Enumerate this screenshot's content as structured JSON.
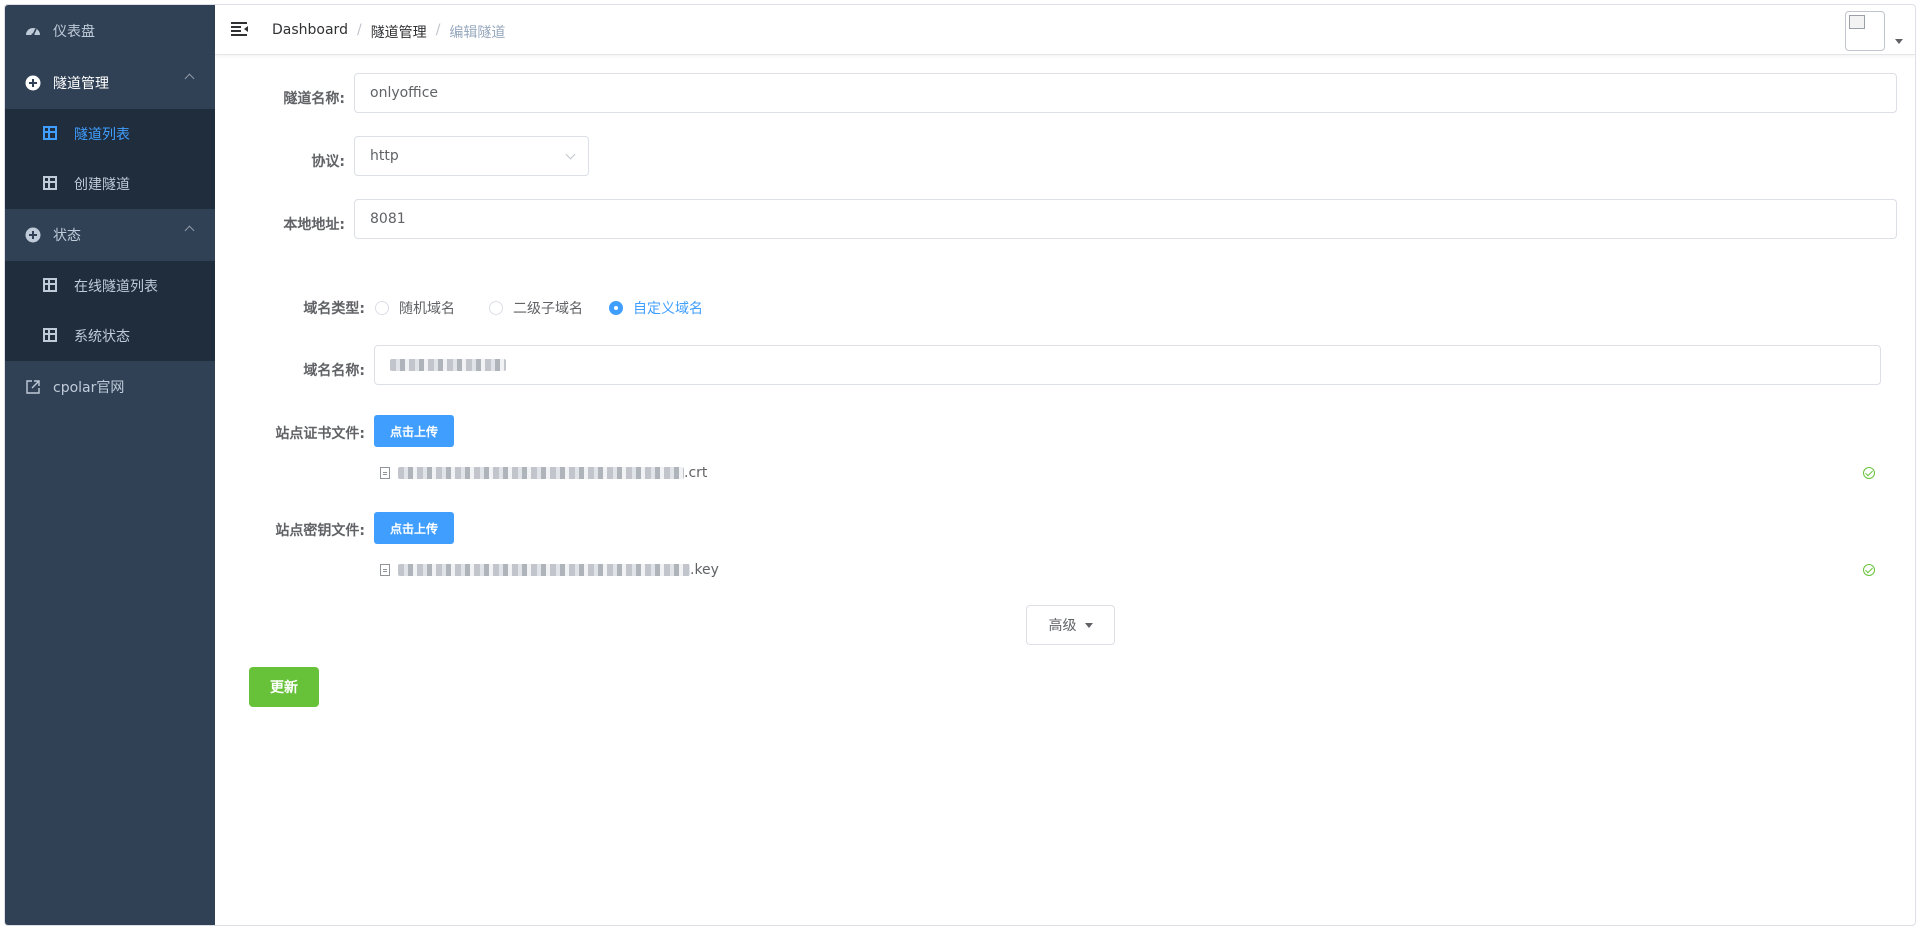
{
  "sidebar": {
    "dashboard": "仪表盘",
    "tunnel_mgmt": "隧道管理",
    "tunnel_list": "隧道列表",
    "create_tunnel": "创建隧道",
    "status": "状态",
    "online_tunnels": "在线隧道列表",
    "system_status": "系统状态",
    "website": "cpolar官网"
  },
  "breadcrumb": [
    "Dashboard",
    "隧道管理",
    "编辑隧道"
  ],
  "form": {
    "tunnel_name_label": "隧道名称:",
    "tunnel_name_value": "onlyoffice",
    "protocol_label": "协议:",
    "protocol_value": "http",
    "local_addr_label": "本地地址:",
    "local_addr_value": "8081",
    "domain_type_label": "域名类型:",
    "domain_type_options": [
      "随机域名",
      "二级子域名",
      "自定义域名"
    ],
    "domain_type_selected": "自定义域名",
    "domain_name_label": "域名名称:",
    "cert_label": "站点证书文件:",
    "key_label": "站点密钥文件:",
    "upload_label": "点击上传",
    "cert_file_ext": ".crt",
    "key_file_ext": ".key",
    "advanced_label": "高级",
    "update_label": "更新"
  },
  "colors": {
    "sidebar_bg": "#304156",
    "submenu_bg": "#1f2d3d",
    "primary": "#409eff",
    "success": "#67c23a"
  }
}
